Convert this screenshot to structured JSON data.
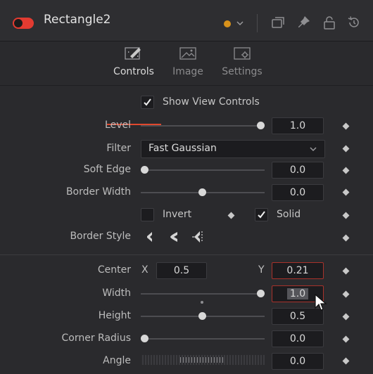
{
  "header": {
    "tool_name": "Rectangle2",
    "enabled": true,
    "color_accent": "#d8921b",
    "icons": [
      "toggle-icon",
      "color-dot-icon",
      "chevron-down-icon",
      "windows-icon",
      "pin-icon",
      "lock-icon",
      "reset-icon"
    ]
  },
  "tabs": [
    {
      "label": "Controls",
      "icon": "controls-tab-icon",
      "active": true
    },
    {
      "label": "Image",
      "icon": "image-tab-icon",
      "active": false
    },
    {
      "label": "Settings",
      "icon": "settings-tab-icon",
      "active": false
    }
  ],
  "controls": {
    "show_view_controls": {
      "label": "Show View Controls",
      "checked": true
    },
    "level": {
      "label": "Level",
      "value": "1.0",
      "slider_fraction": 1.0
    },
    "filter": {
      "label": "Filter",
      "value": "Fast Gaussian"
    },
    "soft_edge": {
      "label": "Soft Edge",
      "value": "0.0",
      "slider_fraction": 0.0
    },
    "border_width": {
      "label": "Border Width",
      "value": "0.0",
      "slider_fraction": 0.5
    },
    "invert": {
      "label": "Invert",
      "checked": false
    },
    "solid": {
      "label": "Solid",
      "checked": true
    },
    "border_style": {
      "label": "Border Style",
      "options": [
        "bevel-join-icon",
        "round-join-icon",
        "miter-join-icon"
      ]
    },
    "center": {
      "label": "Center",
      "x_label": "X",
      "x_value": "0.5",
      "y_label": "Y",
      "y_value": "0.21"
    },
    "width": {
      "label": "Width",
      "value": "1.0",
      "slider_fraction": 1.0
    },
    "height": {
      "label": "Height",
      "value": "0.5",
      "slider_fraction": 0.5
    },
    "corner_radius": {
      "label": "Corner Radius",
      "value": "0.0",
      "slider_fraction": 0.0
    },
    "angle": {
      "label": "Angle",
      "value": "0.0"
    }
  },
  "colors": {
    "accent_red": "#e0482e",
    "highlight_border": "#a8322b",
    "panel_bg": "#2a2a2d"
  }
}
